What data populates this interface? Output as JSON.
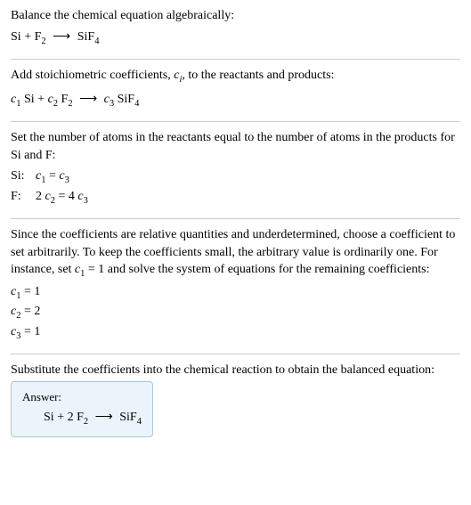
{
  "step1": {
    "text": "Balance the chemical equation algebraically:",
    "eq_lhs1": "Si",
    "eq_plus": " + ",
    "eq_lhs2": "F",
    "eq_lhs2_sub": "2",
    "arrow": "⟶",
    "eq_rhs": "SiF",
    "eq_rhs_sub": "4"
  },
  "step2": {
    "text1": "Add stoichiometric coefficients, ",
    "ci": "c",
    "ci_sub": "i",
    "text2": ", to the reactants and products:",
    "c1": "c",
    "c1_sub": "1",
    "sp": " ",
    "si": "Si",
    "plus": " + ",
    "c2": "c",
    "c2_sub": "2",
    "f": "F",
    "f_sub": "2",
    "arrow": "⟶",
    "c3": "c",
    "c3_sub": "3",
    "sif": "SiF",
    "sif_sub": "4"
  },
  "step3": {
    "text": "Set the number of atoms in the reactants equal to the number of atoms in the products for Si and F:",
    "si_label": "Si:",
    "si_eq_c1": "c",
    "si_eq_c1_sub": "1",
    "si_eq_mid": " = ",
    "si_eq_c3": "c",
    "si_eq_c3_sub": "3",
    "f_label": "F:",
    "f_eq_pre": "2 ",
    "f_eq_c2": "c",
    "f_eq_c2_sub": "2",
    "f_eq_mid": " = 4 ",
    "f_eq_c3": "c",
    "f_eq_c3_sub": "3"
  },
  "step4": {
    "text1": "Since the coefficients are relative quantities and underdetermined, choose a coefficient to set arbitrarily. To keep the coefficients small, the arbitrary value is ordinarily one. For instance, set ",
    "c1": "c",
    "c1_sub": "1",
    "text2": " = 1 and solve the system of equations for the remaining coefficients:",
    "line1_c": "c",
    "line1_sub": "1",
    "line1_val": " = 1",
    "line2_c": "c",
    "line2_sub": "2",
    "line2_val": " = 2",
    "line3_c": "c",
    "line3_sub": "3",
    "line3_val": " = 1"
  },
  "step5": {
    "text": "Substitute the coefficients into the chemical reaction to obtain the balanced equation:"
  },
  "answer": {
    "label": "Answer:",
    "si": "Si",
    "plus": " + ",
    "two": "2 ",
    "f": "F",
    "f_sub": "2",
    "arrow": "⟶",
    "sif": "SiF",
    "sif_sub": "4"
  }
}
